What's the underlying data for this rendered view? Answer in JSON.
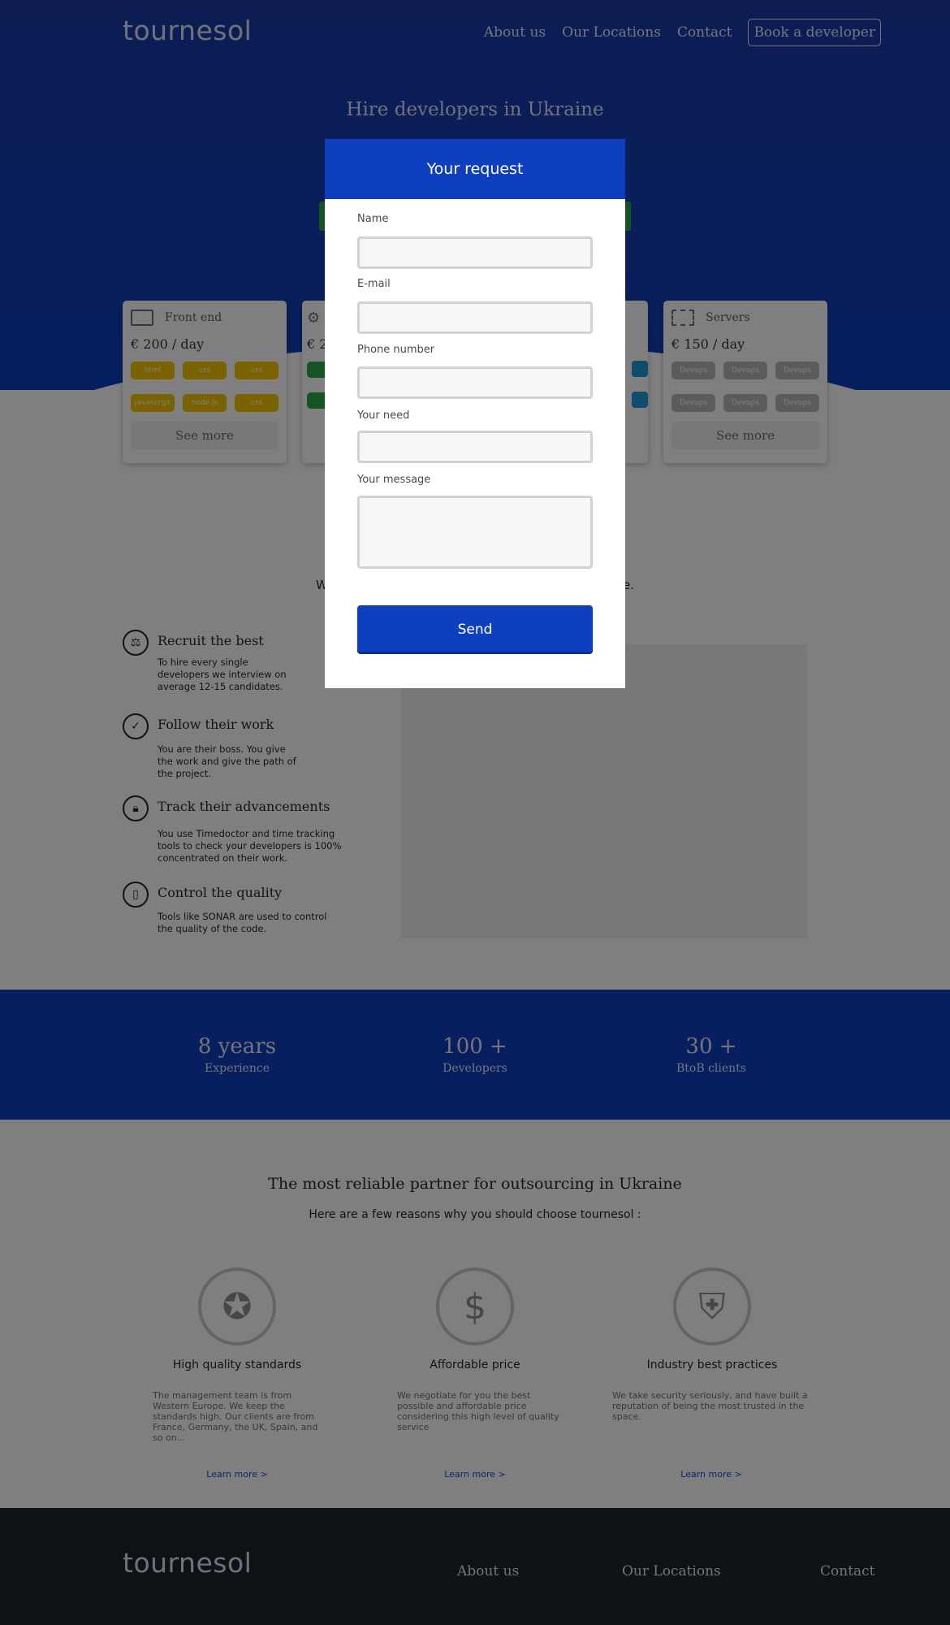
{
  "header": {
    "logo": "tournesol",
    "nav": [
      {
        "label": "About us"
      },
      {
        "label": "Our Locations"
      },
      {
        "label": "Contact"
      }
    ],
    "book_button": "Book a developer"
  },
  "hero": {
    "title": "Hire developers in Ukraine"
  },
  "cards": [
    {
      "title": "Front end",
      "price": "€ 200 / day",
      "tags": [
        "html",
        "css",
        "css",
        "javascript",
        "node.js",
        "css"
      ],
      "tag_color": "#f5c400",
      "button": "See more",
      "icon": "laptop-icon"
    },
    {
      "title": "Servers",
      "price": "€ 150 / day",
      "tags": [
        "Devops",
        "Devops",
        "Devops",
        "Devops",
        "Devops",
        "Devops"
      ],
      "tag_color": "#b3b6bb",
      "button": "See more",
      "icon": "server-icon"
    },
    {
      "partial_price": "€ 2"
    }
  ],
  "features_intro": {
    "left": "W",
    "right": "e."
  },
  "features": [
    {
      "title": "Recruit the best",
      "text": "To hire every single developers we interview on average 12-15 candidates.",
      "icon": "scale-icon"
    },
    {
      "title": "Follow their work",
      "text": "You are their boss. You give the work and give the path of the project.",
      "icon": "check-circle-icon"
    },
    {
      "title": "Track their advancements",
      "text": "You use Timedoctor and time tracking tools to check your developers is 100% concentrated on their work.",
      "icon": "lock-icon"
    },
    {
      "title": "Control the quality",
      "text": "Tools like SONAR are used to control the quality of the code.",
      "icon": "phone-icon"
    }
  ],
  "stats": [
    {
      "value": "8 years",
      "label": "Experience"
    },
    {
      "value": "100 +",
      "label": "Developers"
    },
    {
      "value": "30 +",
      "label": "BtoB clients"
    }
  ],
  "partner": {
    "title": "The most reliable partner for outsourcing in Ukraine",
    "subtitle": "Here are a few reasons why you should choose tournesol :",
    "reasons": [
      {
        "title": "High quality standards",
        "text": "The management team is from Western Europe. We keep the standards high. Our clients are from France, Germany, the UK, Spain, and so on...",
        "link": "Learn more >",
        "icon": "award-icon"
      },
      {
        "title": "Affordable price",
        "text": "We negotiate for you the best possible and affordable price considering this high level of quality service",
        "link": "Learn more >",
        "icon": "price-icon"
      },
      {
        "title": "Industry best practices",
        "text": "We take security seriously, and have built a reputation of being the most trusted in the space.",
        "link": "Learn more >",
        "icon": "shield-icon"
      }
    ]
  },
  "footer": {
    "logo": "tournesol",
    "links": [
      {
        "label": "About us"
      },
      {
        "label": "Our Locations"
      },
      {
        "label": "Contact"
      }
    ]
  },
  "modal": {
    "title": "Your request",
    "fields": [
      {
        "label": "Name",
        "value": ""
      },
      {
        "label": "E-mail",
        "value": ""
      },
      {
        "label": "Phone number",
        "value": ""
      },
      {
        "label": "Your need",
        "value": ""
      },
      {
        "label": "Your message",
        "value": ""
      }
    ],
    "send": "Send"
  },
  "colors": {
    "brand_blue": "#0e3fbe",
    "overlay": "rgba(0,0,0,0.5)",
    "footer": "#1c252e"
  }
}
